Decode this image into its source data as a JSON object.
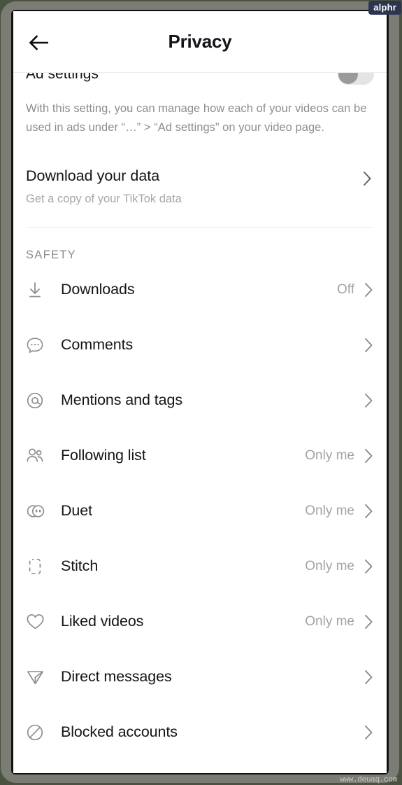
{
  "header": {
    "title": "Privacy",
    "back_icon": "arrow-left-icon"
  },
  "ad_settings": {
    "title": "Ad settings",
    "toggle_state": "off",
    "description": "With this setting, you can manage how each of your videos can be used in ads under “…” > “Ad settings” on your video page."
  },
  "download_data": {
    "title": "Download your data",
    "subtitle": "Get a copy of your TikTok data",
    "chevron": "chevron-right-icon"
  },
  "safety": {
    "section_label": "SAFETY",
    "items": [
      {
        "label": "Downloads",
        "value": "Off",
        "icon": "download-icon"
      },
      {
        "label": "Comments",
        "value": "",
        "icon": "comment-bubble-icon"
      },
      {
        "label": "Mentions and tags",
        "value": "",
        "icon": "at-sign-icon"
      },
      {
        "label": "Following list",
        "value": "Only me",
        "icon": "people-icon"
      },
      {
        "label": "Duet",
        "value": "Only me",
        "icon": "duet-icon"
      },
      {
        "label": "Stitch",
        "value": "Only me",
        "icon": "stitch-icon"
      },
      {
        "label": "Liked videos",
        "value": "Only me",
        "icon": "heart-icon"
      },
      {
        "label": "Direct messages",
        "value": "",
        "icon": "send-icon"
      },
      {
        "label": "Blocked accounts",
        "value": "",
        "icon": "block-icon"
      }
    ]
  },
  "watermarks": {
    "brand": "alphr",
    "site": "www.deuaq.com"
  },
  "colors": {
    "text_primary": "#14141a",
    "text_secondary": "#8d8d92",
    "value_gray": "#a3a3a8",
    "icon_gray": "#8e8e93",
    "divider": "#ececec",
    "watermark_navy": "#2c3550"
  }
}
